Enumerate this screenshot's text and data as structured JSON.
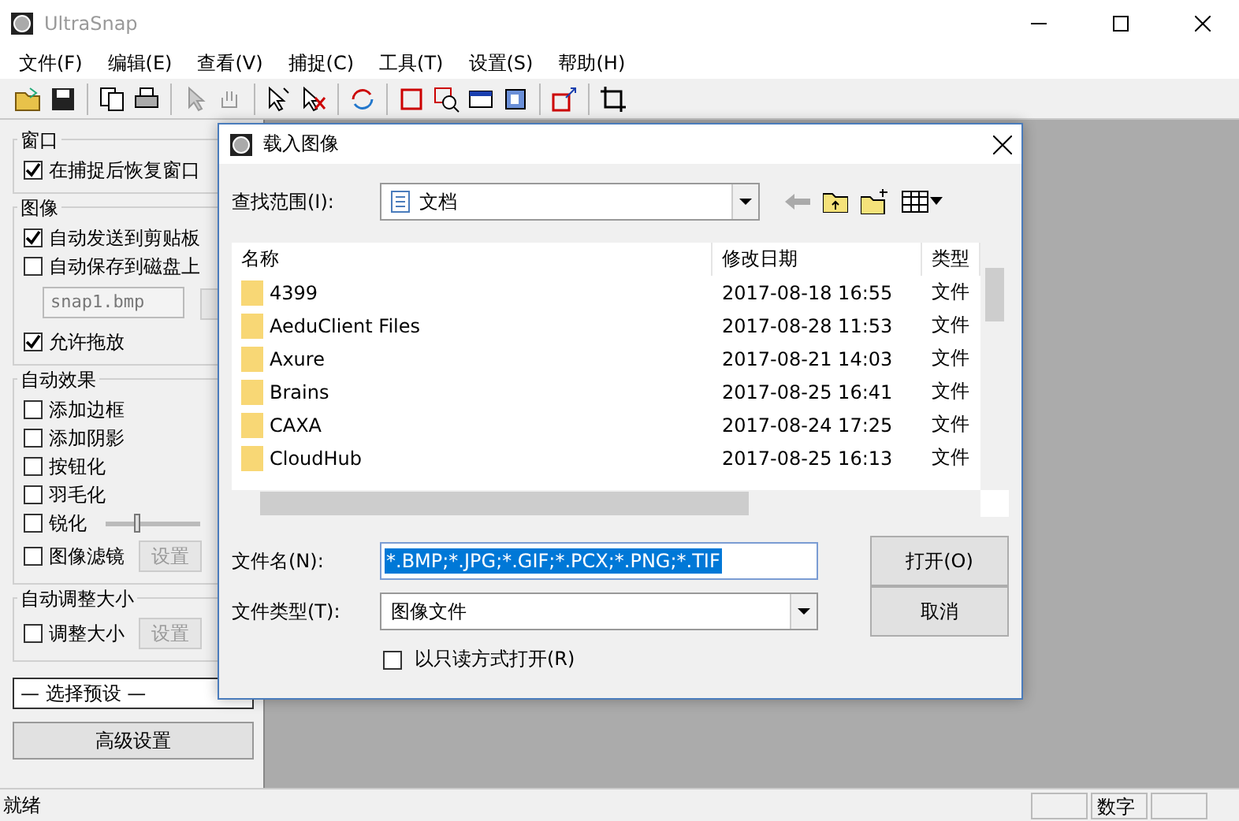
{
  "window": {
    "title": "UltraSnap"
  },
  "menu": [
    "文件(F)",
    "编辑(E)",
    "查看(V)",
    "捕捉(C)",
    "工具(T)",
    "设置(S)",
    "帮助(H)"
  ],
  "panel": {
    "groups": [
      {
        "title": "窗口",
        "items": [
          {
            "kind": "check",
            "label": "在捕捉后恢复窗口",
            "checked": true
          }
        ]
      },
      {
        "title": "图像",
        "items": [
          {
            "kind": "check",
            "label": "自动发送到剪贴板",
            "checked": true
          },
          {
            "kind": "check",
            "label": "自动保存到磁盘上",
            "checked": false
          },
          {
            "kind": "file",
            "value": "snap1.bmp"
          },
          {
            "kind": "check",
            "label": "允许拖放",
            "checked": true
          }
        ]
      },
      {
        "title": "自动效果",
        "items": [
          {
            "kind": "check",
            "label": "添加边框",
            "checked": false
          },
          {
            "kind": "check",
            "label": "添加阴影",
            "checked": false
          },
          {
            "kind": "check",
            "label": "按钮化",
            "checked": false
          },
          {
            "kind": "check",
            "label": "羽毛化",
            "checked": false
          },
          {
            "kind": "slider",
            "label": "锐化",
            "checked": false,
            "level": 0.3
          },
          {
            "kind": "button",
            "label": "图像滤镜",
            "checked": false,
            "button": "设置"
          }
        ]
      },
      {
        "title": "自动调整大小",
        "items": [
          {
            "kind": "button",
            "label": "调整大小",
            "checked": false,
            "button": "设置"
          }
        ]
      }
    ],
    "preset": "— 选择预设 —",
    "advanced": "高级设置"
  },
  "dialog": {
    "title": "载入图像",
    "look_in_label": "查找范围(I):",
    "look_in": "文档",
    "columns": [
      "名称",
      "修改日期",
      "类型"
    ],
    "rows": [
      {
        "name": "4399",
        "date": "2017-08-18 16:55",
        "type": "文件"
      },
      {
        "name": "AeduClient Files",
        "date": "2017-08-28 11:53",
        "type": "文件"
      },
      {
        "name": "Axure",
        "date": "2017-08-21 14:03",
        "type": "文件"
      },
      {
        "name": "Brains",
        "date": "2017-08-25 16:41",
        "type": "文件"
      },
      {
        "name": "CAXA",
        "date": "2017-08-24 17:25",
        "type": "文件"
      },
      {
        "name": "CloudHub",
        "date": "2017-08-25 16:13",
        "type": "文件"
      }
    ],
    "filename_label": "文件名(N):",
    "filename": {
      "value": "*.BMP;*.JPG;*.GIF;*.PCX;*.PNG;*.TIF",
      "selected": true
    },
    "filetype_label": "文件类型(T):",
    "filetype": "图像文件",
    "buttons": [
      "打开(O)",
      "取消"
    ],
    "readonly": {
      "label": "以只读方式打开(R)",
      "checked": false
    }
  },
  "status": {
    "text": "就绪",
    "panes": [
      "数字"
    ]
  }
}
